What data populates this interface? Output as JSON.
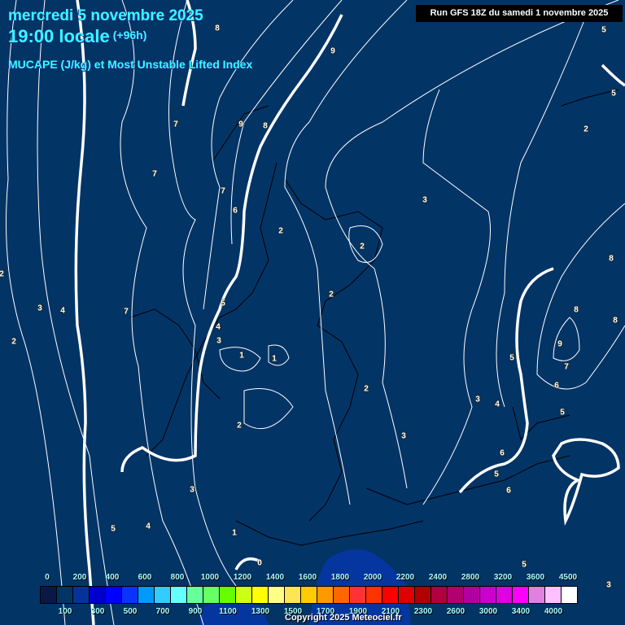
{
  "header": {
    "date": "mercredi 5 novembre 2025",
    "time": "19:00 locale",
    "lead": "(+96h)",
    "product": "MUCAPE (J/kg) et Most Unstable Lifted Index",
    "run": "Run GFS 18Z du samedi 1 novembre 2025"
  },
  "contour_labels": [
    "8",
    "9",
    "7",
    "9",
    "8",
    "7",
    "7",
    "6",
    "3",
    "2",
    "2",
    "2",
    "5",
    "5",
    "8",
    "2",
    "2",
    "5",
    "7",
    "3",
    "4",
    "8",
    "8",
    "4",
    "3",
    "9",
    "2",
    "1",
    "1",
    "5",
    "7",
    "6",
    "2",
    "3",
    "4",
    "5",
    "2",
    "3",
    "6",
    "5",
    "3",
    "6",
    "5",
    "4",
    "1",
    "0",
    "5",
    "3"
  ],
  "legend": {
    "top_labels": [
      "0",
      "200",
      "400",
      "600",
      "800",
      "1000",
      "1200",
      "1400",
      "1600",
      "1800",
      "2000",
      "2200",
      "2400",
      "2800",
      "3200",
      "3600",
      "4500"
    ],
    "bottom_labels": [
      "100",
      "300",
      "500",
      "700",
      "900",
      "1100",
      "1300",
      "1500",
      "1700",
      "1900",
      "2100",
      "2300",
      "2600",
      "3000",
      "3400",
      "4000"
    ],
    "colors": [
      "#0a1848",
      "#033466",
      "#05339a",
      "#0000cc",
      "#0000ff",
      "#0a33ff",
      "#0099ff",
      "#33ccff",
      "#66ffff",
      "#66ff99",
      "#66ff66",
      "#66ff00",
      "#ccff11",
      "#ffff00",
      "#ffff88",
      "#ffe455",
      "#ffcc00",
      "#ff9900",
      "#ff6600",
      "#ff3333",
      "#ff3300",
      "#ff0000",
      "#e00000",
      "#b00000",
      "#b00040",
      "#b00070",
      "#b000a0",
      "#cc00cc",
      "#e000e0",
      "#ff00ff",
      "#e080e0",
      "#ffc0ff",
      "#ffffff"
    ]
  },
  "copyright": "Copyright 2025 Meteociel.fr",
  "colors": {
    "background": "#033466",
    "title": "#33ffff",
    "cape_patch": "#0536a0"
  }
}
